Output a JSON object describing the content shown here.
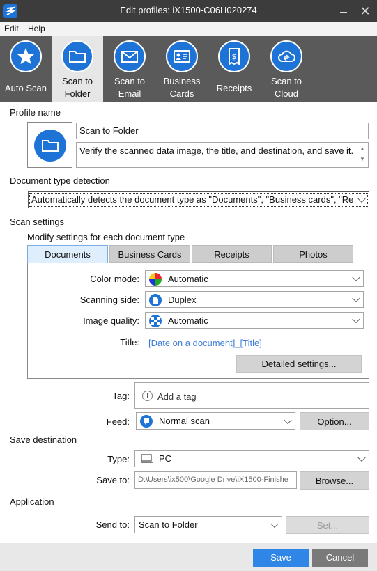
{
  "window": {
    "title": "Edit profiles: iX1500-C06H020274"
  },
  "menu": {
    "items": [
      "Edit",
      "Help"
    ]
  },
  "toolbar": {
    "items": [
      {
        "line1": "Auto Scan",
        "line2": "",
        "icon": "star-icon"
      },
      {
        "line1": "Scan to",
        "line2": "Folder",
        "icon": "folder-icon"
      },
      {
        "line1": "Scan to",
        "line2": "Email",
        "icon": "envelope-icon"
      },
      {
        "line1": "Business",
        "line2": "Cards",
        "icon": "business-card-icon"
      },
      {
        "line1": "Receipts",
        "line2": "",
        "icon": "receipt-icon"
      },
      {
        "line1": "Scan to",
        "line2": "Cloud",
        "icon": "cloud-icon"
      }
    ],
    "active_index": 1
  },
  "profile": {
    "section_label": "Profile name",
    "name": "Scan to Folder",
    "description": "Verify the scanned data image, the title, and destination, and save it."
  },
  "doc_type_detection": {
    "section_label": "Document type detection",
    "value": "Automatically detects the document type as \"Documents\", \"Business cards\", \"Re"
  },
  "scan_settings": {
    "section_label": "Scan settings",
    "sub_label": "Modify settings for each document type",
    "tabs": [
      "Documents",
      "Business Cards",
      "Receipts",
      "Photos"
    ],
    "active_tab": 0,
    "color_mode": {
      "label": "Color mode:",
      "value": "Automatic"
    },
    "scanning_side": {
      "label": "Scanning side:",
      "value": "Duplex"
    },
    "image_quality": {
      "label": "Image quality:",
      "value": "Automatic"
    },
    "title": {
      "label": "Title:",
      "value": "[Date on a document]_[Title]"
    },
    "detailed_button": "Detailed settings..."
  },
  "tag": {
    "label": "Tag:",
    "placeholder": "Add a tag"
  },
  "feed": {
    "label": "Feed:",
    "value": "Normal scan",
    "option_button": "Option..."
  },
  "save_destination": {
    "section_label": "Save destination",
    "type_label": "Type:",
    "type_value": "PC",
    "save_to_label": "Save to:",
    "save_to_value": "D:\\Users\\ix500\\Google Drive\\iX1500-Finishe",
    "browse_button": "Browse..."
  },
  "application": {
    "section_label": "Application",
    "send_to_label": "Send to:",
    "send_to_value": "Scan to Folder",
    "set_button": "Set..."
  },
  "footer": {
    "save": "Save",
    "cancel": "Cancel"
  },
  "colors": {
    "accent": "#1e74d6",
    "save_button": "#2f86e6",
    "cancel_button": "#7a7a7a",
    "toolbar_bg": "#5a5a5a",
    "titlebar_bg": "#3c3c3c"
  }
}
